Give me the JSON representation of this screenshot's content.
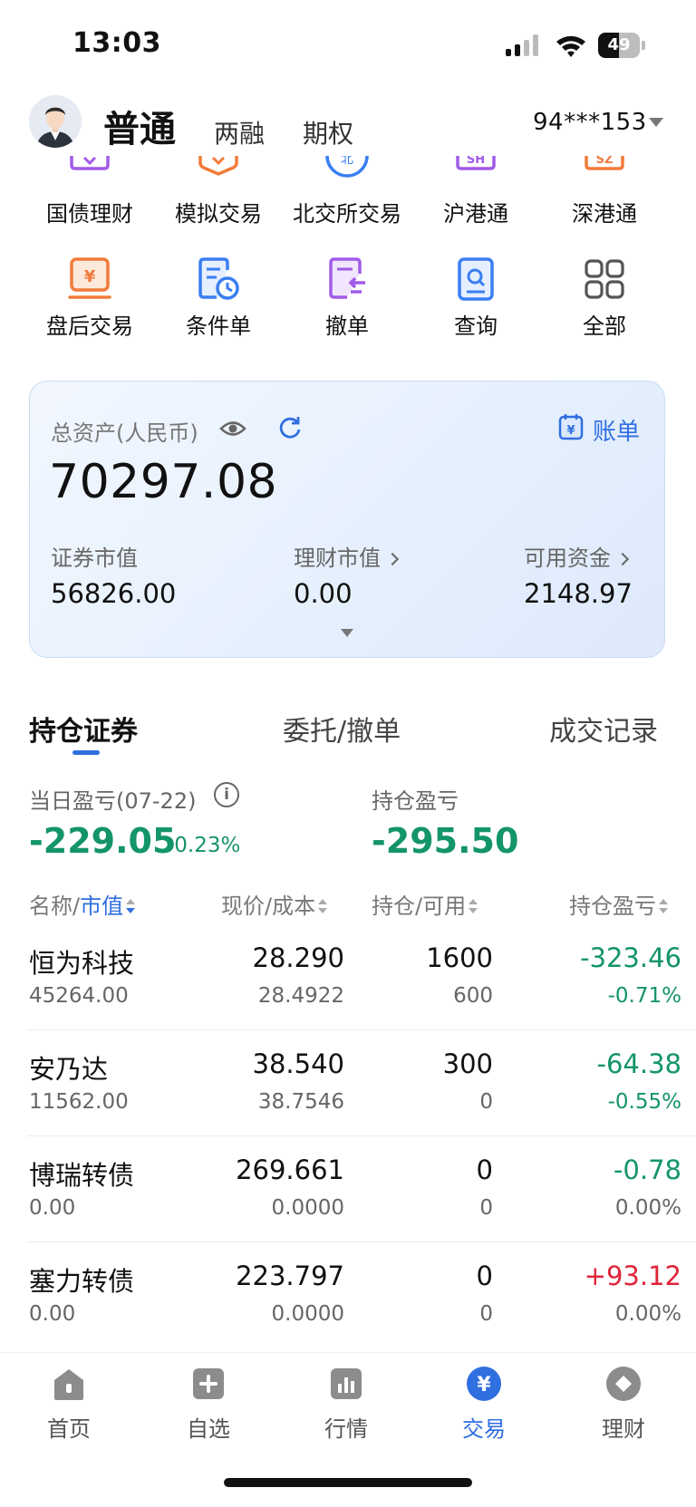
{
  "status_bar": {
    "time": "13:03",
    "battery": "49",
    "battery_level": 0.49
  },
  "header": {
    "tabs": [
      {
        "label": "普通",
        "active": true
      },
      {
        "label": "两融",
        "active": false
      },
      {
        "label": "期权",
        "active": false
      }
    ],
    "account": "94***153"
  },
  "quick_menu": {
    "row1": [
      {
        "label": "国债理财",
        "icon": "bond-icon",
        "color": "#a15be8"
      },
      {
        "label": "模拟交易",
        "icon": "simulate-icon",
        "color": "#f27b3a"
      },
      {
        "label": "北交所交易",
        "icon": "bj-exchange-icon",
        "color": "#3a7ef2"
      },
      {
        "label": "沪港通",
        "icon": "sh-connect-icon",
        "color": "#a15be8"
      },
      {
        "label": "深港通",
        "icon": "sz-connect-icon",
        "color": "#f27b3a"
      }
    ],
    "row2": [
      {
        "label": "盘后交易",
        "icon": "after-hours-icon",
        "color": "#f27b3a"
      },
      {
        "label": "条件单",
        "icon": "condition-order-icon",
        "color": "#3a7ef2"
      },
      {
        "label": "撤单",
        "icon": "cancel-order-icon",
        "color": "#a15be8"
      },
      {
        "label": "查询",
        "icon": "query-icon",
        "color": "#3a7ef2"
      },
      {
        "label": "全部",
        "icon": "grid-icon",
        "color": "#555555"
      }
    ],
    "row1_badges": {
      "bj": "北",
      "sh": "SH",
      "sz": "SZ"
    },
    "yen": "¥"
  },
  "asset_card": {
    "label": "总资产(人民币)",
    "bill_label": "账单",
    "total": "70297.08",
    "items": [
      {
        "label": "证券市值",
        "value": "56826.00"
      },
      {
        "label": "理财市值",
        "value": "0.00"
      },
      {
        "label": "可用资金",
        "value": "2148.97"
      }
    ]
  },
  "holdings_tabs": [
    {
      "label": "持仓证券",
      "active": true
    },
    {
      "label": "委托/撤单",
      "active": false
    },
    {
      "label": "成交记录",
      "active": false
    }
  ],
  "pnl": {
    "daily_label": "当日盈亏(07-22)",
    "daily_value": "-229.05",
    "daily_pct": "-0.23%",
    "position_label": "持仓盈亏",
    "position_value": "-295.50",
    "info": "i"
  },
  "table": {
    "columns": {
      "name_prefix": "名称/",
      "name_sort": "市值",
      "price": "现价/成本",
      "qty": "持仓/可用",
      "pl": "持仓盈亏"
    },
    "rows": [
      {
        "name": "恒为科技",
        "market_value": "45264.00",
        "price": "28.290",
        "cost": "28.4922",
        "qty": "1600",
        "available": "600",
        "pl": "-323.46",
        "pl_pct": "-0.71%"
      },
      {
        "name": "安乃达",
        "market_value": "11562.00",
        "price": "38.540",
        "cost": "38.7546",
        "qty": "300",
        "available": "0",
        "pl": "-64.38",
        "pl_pct": "-0.55%"
      },
      {
        "name": "博瑞转债",
        "market_value": "0.00",
        "price": "269.661",
        "cost": "0.0000",
        "qty": "0",
        "available": "0",
        "pl": "-0.78",
        "pl_pct": "0.00%"
      },
      {
        "name": "塞力转债",
        "market_value": "0.00",
        "price": "223.797",
        "cost": "0.0000",
        "qty": "0",
        "available": "0",
        "pl": "+93.12",
        "pl_pct": "0.00%"
      }
    ]
  },
  "bottom_nav": [
    {
      "label": "首页",
      "icon": "home-icon",
      "active": false
    },
    {
      "label": "自选",
      "icon": "watchlist-icon",
      "active": false
    },
    {
      "label": "行情",
      "icon": "market-icon",
      "active": false
    },
    {
      "label": "交易",
      "icon": "trade-yen-icon",
      "active": true
    },
    {
      "label": "理财",
      "icon": "wealth-icon",
      "active": false
    }
  ],
  "colors": {
    "accent": "#2f6fe0",
    "loss": "#14946a",
    "gain": "#e0243a"
  }
}
